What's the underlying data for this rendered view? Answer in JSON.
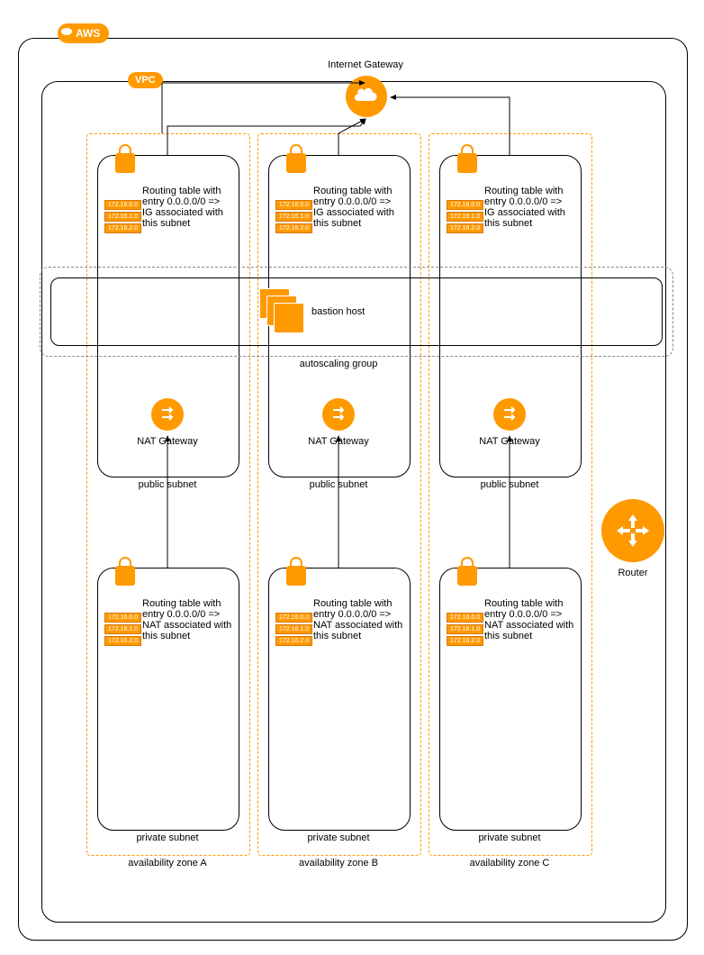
{
  "aws": "AWS",
  "vpc": "VPC",
  "ig": "Internet Gateway",
  "bastion": "bastion host",
  "asg": "autoscaling group",
  "nat": "NAT Gateway",
  "router": "Router",
  "pubsubnet": "public subnet",
  "privsubnet": "private subnet",
  "rt_ig": "Routing table with entry 0.0.0.0/0 => IG associated with this subnet",
  "rt_nat": "Routing table with entry 0.0.0.0/0 => NAT associated with this subnet",
  "ip1": "172.16.0.0",
  "ip2": "172.16.1.0",
  "ip3": "172.16.2.0",
  "azA": "availability zone A",
  "azB": "availability zone B",
  "azC": "availability zone C"
}
